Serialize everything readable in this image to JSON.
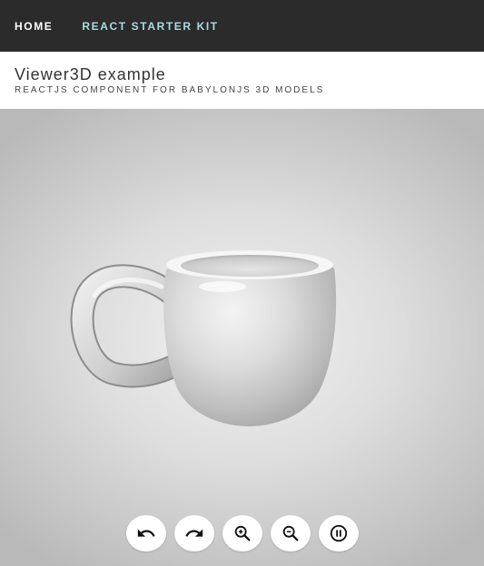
{
  "nav": {
    "home_label": "HOME",
    "starter_label": "REACT STARTER KIT"
  },
  "header": {
    "title": "Viewer3D example",
    "subtitle": "REACTJS COMPONENT FOR BABYLONJS 3D MODELS"
  },
  "viewer": {
    "model": "coffee-mug",
    "controls": [
      {
        "name": "undo-rotate-button",
        "icon": "undo-icon"
      },
      {
        "name": "redo-rotate-button",
        "icon": "redo-icon"
      },
      {
        "name": "zoom-in-button",
        "icon": "zoom-in-icon"
      },
      {
        "name": "zoom-out-button",
        "icon": "zoom-out-icon"
      },
      {
        "name": "pause-button",
        "icon": "pause-icon"
      }
    ]
  },
  "colors": {
    "navbar_bg": "#2b2b2b",
    "nav_home": "#ffffff",
    "nav_starter": "#a8dbe0",
    "viewer_bg_center": "#f2f2f2",
    "viewer_bg_edge": "#b9b9b9"
  }
}
